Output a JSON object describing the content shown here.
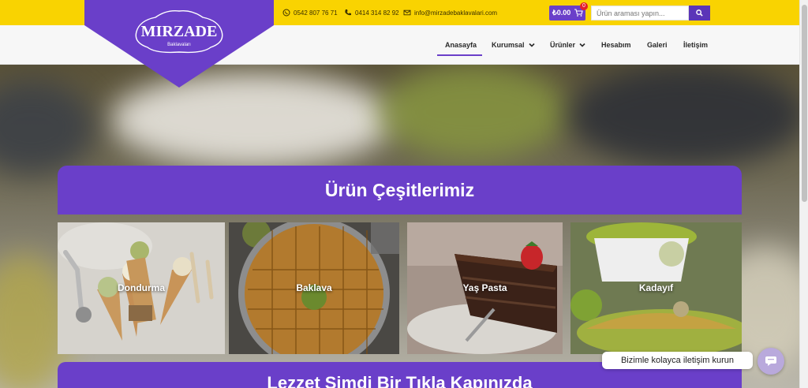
{
  "logo": {
    "name": "MIRZADE",
    "sub": "Baklavaları"
  },
  "contact": {
    "phone1": "0542 807 76 71",
    "phone2": "0414 314 82 92",
    "email": "info@mirzadebaklavalari.com"
  },
  "cart": {
    "amount": "₺0.00",
    "count": "0"
  },
  "search": {
    "placeholder": "Ürün araması yapın..."
  },
  "nav": {
    "items": [
      {
        "label": "Anasayfa",
        "active": true
      },
      {
        "label": "Kurumsal",
        "dropdown": true
      },
      {
        "label": "Ürünler",
        "dropdown": true
      },
      {
        "label": "Hesabım"
      },
      {
        "label": "Galeri"
      },
      {
        "label": "İletişim"
      }
    ]
  },
  "hero": {
    "title": "Ürün Çeşitlerimiz",
    "categories": [
      "Dondurma",
      "Baklava",
      "Yaş Pasta",
      "Kadayıf"
    ],
    "bottom_title": "Lezzet Şimdi Bir Tıkla Kapınızda"
  },
  "chat": {
    "text": "Bizimle kolayca iletişim kurun"
  },
  "colors": {
    "brand_purple": "#6a3fc9",
    "topbar_yellow": "#f9d301"
  }
}
